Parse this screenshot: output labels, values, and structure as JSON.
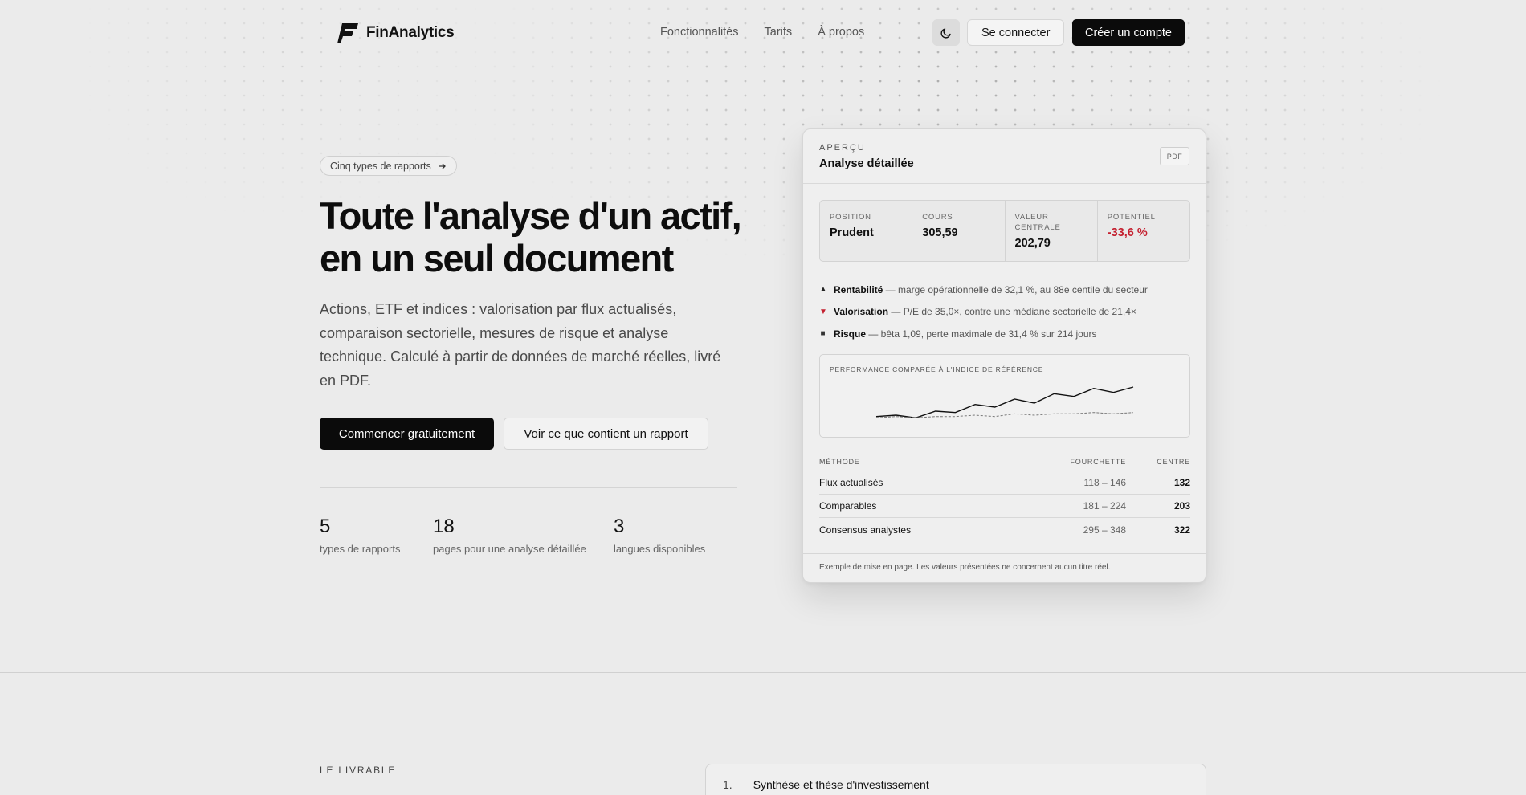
{
  "brand": {
    "name": "FinAnalytics"
  },
  "nav": {
    "links": [
      "Fonctionnalités",
      "Tarifs",
      "À propos"
    ],
    "theme_icon": "moon-icon",
    "login_label": "Se connecter",
    "signup_label": "Créer un compte"
  },
  "hero": {
    "pill_label": "Cinq types de rapports",
    "pill_icon": "arrow-right-icon",
    "title_line1": "Toute l'analyse d'un actif,",
    "title_line2": "en un seul document",
    "subtitle": "Actions, ETF et indices : valorisation par flux actualisés, comparaison sectorielle, mesures de risque et analyse technique. Calculé à partir de données de marché réelles, livré en PDF.",
    "cta_primary": "Commencer gratuitement",
    "cta_secondary": "Voir ce que contient un rapport",
    "stats": [
      {
        "value": "5",
        "label": "types de rapports"
      },
      {
        "value": "18",
        "label": "pages pour une analyse détaillée"
      },
      {
        "value": "3",
        "label": "langues disponibles"
      }
    ]
  },
  "preview": {
    "eyebrow": "APERÇU",
    "title": "Analyse détaillée",
    "badge": "PDF",
    "metrics": [
      {
        "label": "POSITION",
        "value": "Prudent"
      },
      {
        "label": "COURS",
        "value": "305,59"
      },
      {
        "label": "VALEUR CENTRALE",
        "value": "202,79"
      },
      {
        "label": "POTENTIEL",
        "value": "-33,6 %"
      }
    ],
    "bullets": [
      {
        "icon": "triangle-up-icon",
        "bold": "Rentabilité",
        "text": " — marge opérationnelle de 32,1 %, au 88e centile du secteur"
      },
      {
        "icon": "triangle-down-icon",
        "bold": "Valorisation",
        "text": " — P/E de 35,0×, contre une médiane sectorielle de 21,4×"
      },
      {
        "icon": "square-icon",
        "bold": "Risque",
        "text": " — bêta 1,09, perte maximale de 31,4 % sur 214 jours"
      }
    ],
    "chart_title": "PERFORMANCE COMPARÉE À L'INDICE DE RÉFÉRENCE",
    "table": {
      "headers": [
        "MÉTHODE",
        "FOURCHETTE",
        "CENTRE"
      ],
      "rows": [
        [
          "Flux actualisés",
          "118 – 146",
          "132"
        ],
        [
          "Comparables",
          "181 – 224",
          "203"
        ],
        [
          "Consensus analystes",
          "295 – 348",
          "322"
        ]
      ]
    },
    "footnote": "Exemple de mise en page. Les valeurs présentées ne concernent aucun titre réel.",
    "colors": {
      "negative": "#c4202f",
      "primary": "#0b0b0b"
    }
  },
  "chart_data": {
    "type": "line",
    "title": "PERFORMANCE COMPARÉE À L'INDICE DE RÉFÉRENCE",
    "x": [
      0,
      1,
      2,
      3,
      4,
      5,
      6,
      7,
      8,
      9,
      10,
      11,
      12,
      13
    ],
    "series": [
      {
        "values": [
          100,
          101,
          99,
          104,
          103,
          109,
          107,
          113,
          110,
          117,
          115,
          121,
          118,
          122
        ],
        "style": "solid"
      },
      {
        "values": [
          99,
          100,
          99,
          100,
          100,
          101,
          100,
          102,
          101,
          102,
          102,
          103,
          102,
          103
        ],
        "style": "dashed"
      }
    ],
    "ylim": [
      95,
      125
    ],
    "grid": false
  },
  "section2": {
    "eyebrow": "LE LIVRABLE",
    "items": [
      {
        "num": "1.",
        "label": "Synthèse et thèse d'investissement"
      }
    ]
  }
}
